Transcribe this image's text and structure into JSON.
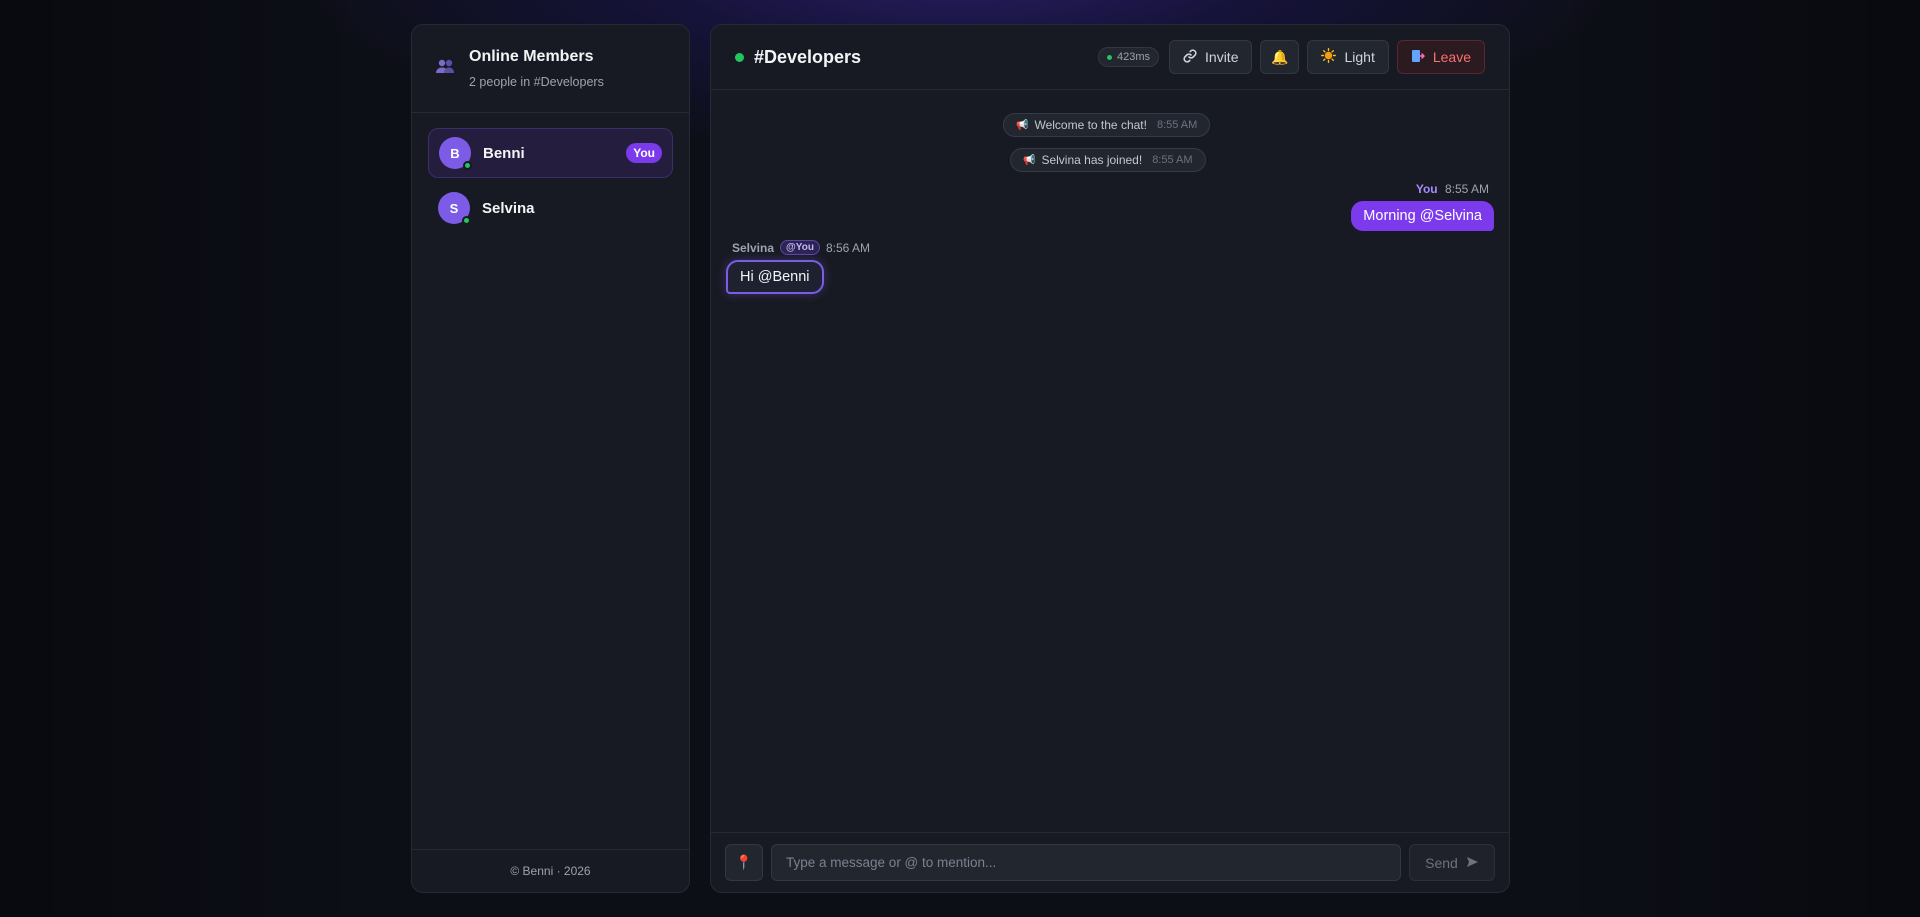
{
  "sidebar": {
    "title": "Online Members",
    "subtitle": "2 people in #Developers",
    "members": [
      {
        "initial": "B",
        "name": "Benni",
        "badge": "You",
        "online": true,
        "active": true
      },
      {
        "initial": "S",
        "name": "Selvina",
        "online": true,
        "active": false
      }
    ],
    "footer": "© Benni · 2026"
  },
  "header": {
    "channel": "#Developers",
    "latency": "423ms",
    "invite_label": "Invite",
    "theme_label": "Light",
    "leave_label": "Leave"
  },
  "messages": {
    "system": [
      {
        "text": "Welcome to the chat!",
        "time": "8:55 AM"
      },
      {
        "text": "Selvina has joined!",
        "time": "8:55 AM"
      }
    ],
    "mine": {
      "author": "You",
      "time": "8:55 AM",
      "text": "Morning @Selvina"
    },
    "theirs": {
      "author": "Selvina",
      "mention_badge": "@You",
      "time": "8:56 AM",
      "text": "Hi @Benni"
    }
  },
  "composer": {
    "placeholder": "Type a message or @ to mention...",
    "send_label": "Send"
  },
  "colors": {
    "accent": "#7c3aed",
    "online": "#22c55e",
    "leave": "#f87171"
  },
  "icons": {
    "people": "people-icon",
    "link": "link-icon",
    "bell": "bell-icon",
    "sun": "sun-icon",
    "door": "door-icon",
    "megaphone": "megaphone-icon",
    "pin": "pin-icon",
    "send": "send-arrow-icon"
  }
}
